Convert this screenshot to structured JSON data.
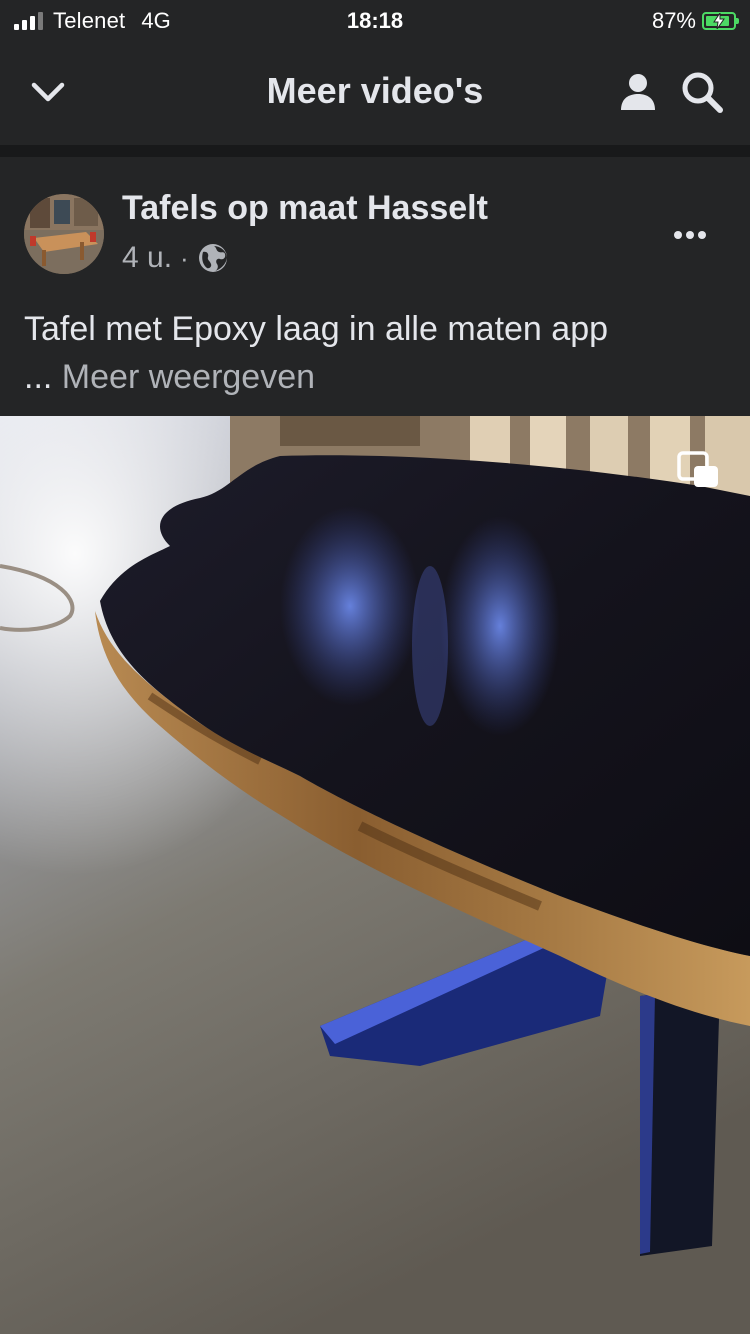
{
  "status_bar": {
    "carrier": "Telenet",
    "network": "4G",
    "time": "18:18",
    "battery_percent": "87%",
    "battery_level": 0.87,
    "signal_bars_active": 3,
    "signal_bars_total": 4
  },
  "header": {
    "title": "Meer video's",
    "back_icon": "chevron-down-icon",
    "profile_icon": "person-icon",
    "search_icon": "search-icon"
  },
  "post": {
    "page_name": "Tafels op maat Hasselt",
    "time": "4 u.",
    "separator": "·",
    "audience_icon": "globe-icon",
    "caption": "Tafel met Epoxy laag in alle maten app",
    "ellipsis": "...",
    "see_more": "Meer weergeven",
    "more_icon": "more-horizontal-icon"
  },
  "video": {
    "pip_icon": "picture-in-picture-icon"
  },
  "colors": {
    "background": "#242526",
    "divider": "#18191a",
    "primary_text": "#e4e6eb",
    "secondary_text": "#b0b3b8",
    "battery_green": "#4cd964"
  }
}
